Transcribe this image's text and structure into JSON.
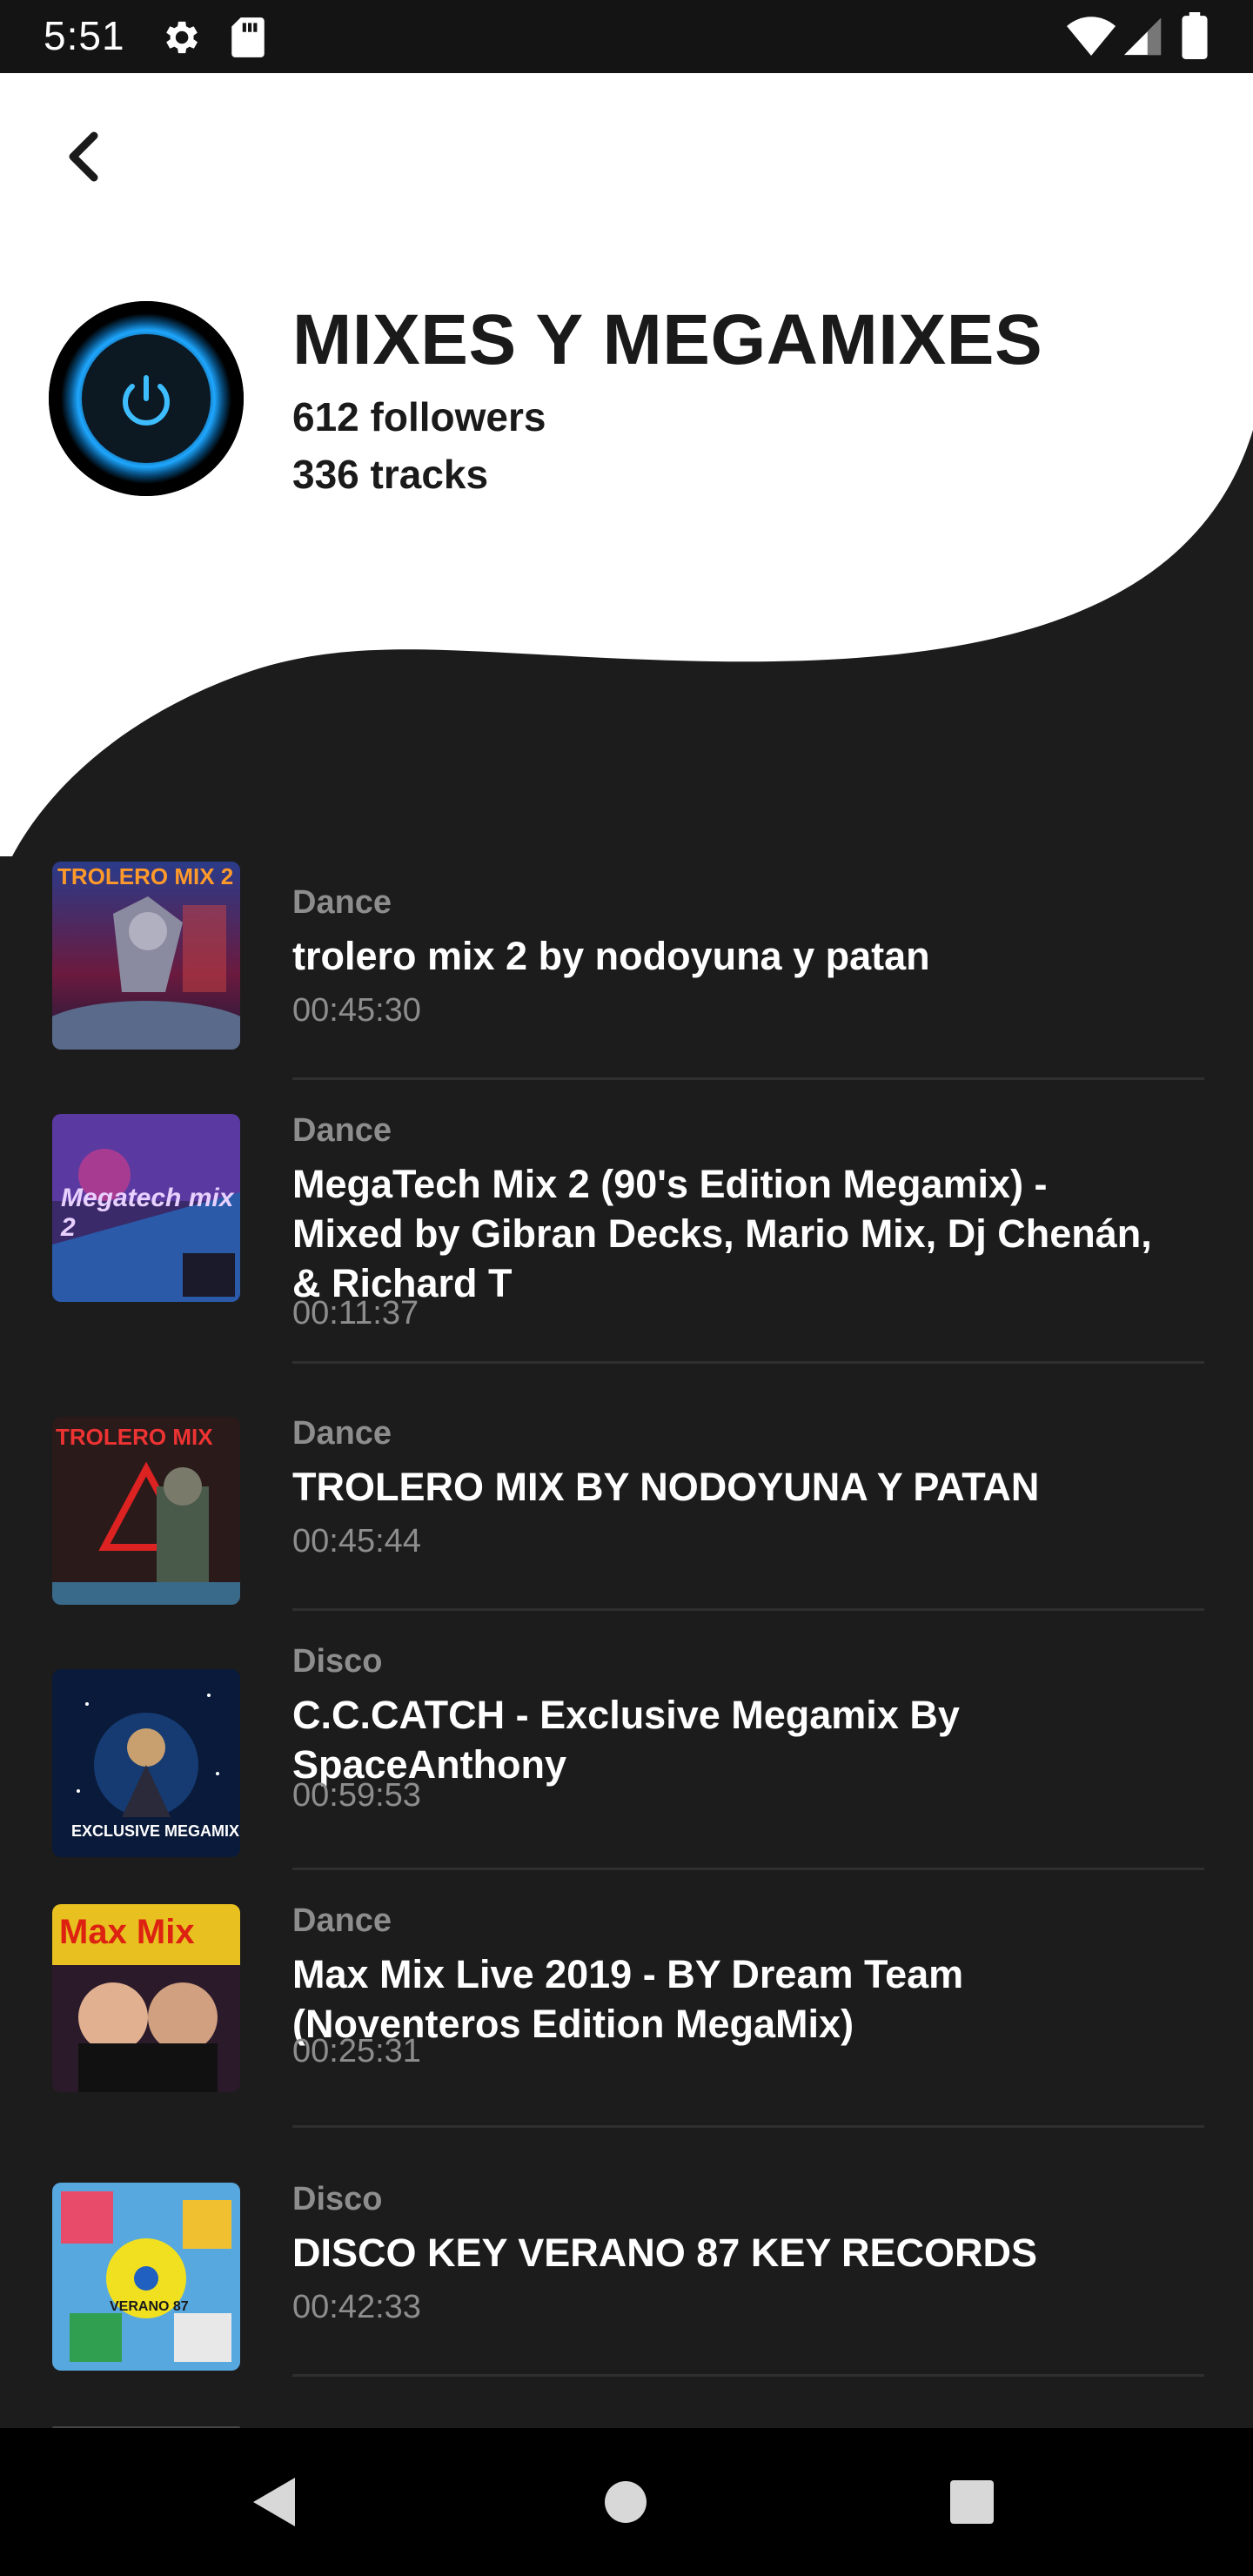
{
  "status_bar": {
    "time": "5:51",
    "icons": [
      "settings-gear-icon",
      "sd-card-icon",
      "wifi-icon",
      "signal-icon",
      "battery-icon"
    ]
  },
  "header": {
    "back_icon": "chevron-left-icon",
    "avatar_icon": "power-button-icon",
    "title": "MIXES Y MEGAMIXES",
    "followers": "612 followers",
    "tracks": "336 tracks"
  },
  "tracks": [
    {
      "genre": "Dance",
      "title": "trolero mix 2 by nodoyuna y patan",
      "duration": "00:45:30",
      "thumb_text": "TROLERO MIX 2"
    },
    {
      "genre": "Dance",
      "title": "MegaTech Mix 2 (90's Edition Megamix) - Mixed by Gibran Decks, Mario Mix, Dj Chenán, & Richard T",
      "duration": "00:11:37",
      "thumb_text": "Megatech mix 2"
    },
    {
      "genre": "Dance",
      "title": "TROLERO MIX BY NODOYUNA Y PATAN",
      "duration": "00:45:44",
      "thumb_text": "TROLERO MIX"
    },
    {
      "genre": "Disco",
      "title": "C.C.CATCH - Exclusive Megamix By SpaceAnthony",
      "duration": "00:59:53",
      "thumb_text": "EXCLUSIVE MEGAMIX"
    },
    {
      "genre": "Dance",
      "title": "Max Mix Live 2019 -  BY Dream Team (Noventeros Edition MegaMix)",
      "duration": "00:25:31",
      "thumb_text": "Max Mix"
    },
    {
      "genre": "Disco",
      "title": "DISCO KEY VERANO 87 KEY RECORDS",
      "duration": "00:42:33",
      "thumb_text": "VERANO 87"
    }
  ],
  "nav_bar": {
    "back": "triangle-back-icon",
    "home": "circle-home-icon",
    "recents": "square-recents-icon"
  },
  "colors": {
    "header_bg": "#ffffff",
    "list_bg": "#1c1c1d",
    "text_primary": "#ffffff",
    "text_secondary": "#8d8d8d",
    "accent_glow": "#1ea7ff"
  }
}
